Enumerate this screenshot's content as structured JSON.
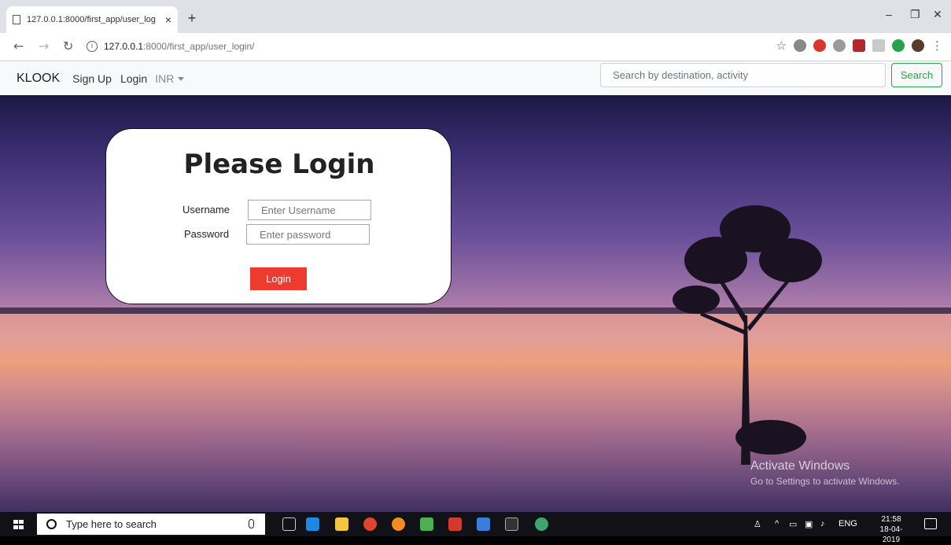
{
  "browser": {
    "tab_title": "127.0.0.1:8000/first_app/user_log",
    "tab_close": "×",
    "new_tab": "+",
    "url_host": "127.0.0.1",
    "url_path": ":8000/first_app/user_login/",
    "info": "i",
    "minimize": "–",
    "restore": "❐",
    "close": "✕"
  },
  "navbar": {
    "brand": "KLOOK",
    "links": [
      "Sign Up",
      "Login"
    ],
    "currency": "INR",
    "search_placeholder": "Search by destination, activity",
    "search_button": "Search"
  },
  "login": {
    "title": "Please Login",
    "username_label": "Username",
    "username_placeholder": "Enter Username",
    "password_label": "Password",
    "password_placeholder": "Enter password",
    "submit": "Login"
  },
  "watermark": {
    "title": "Activate Windows",
    "subtitle": "Go to Settings to activate Windows."
  },
  "taskbar": {
    "search_placeholder": "Type here to search",
    "language": "ENG",
    "time": "21:58",
    "date": "18-04-2019"
  },
  "colors": {
    "login_button": "#ee3a2f",
    "search_button": "#28a745"
  }
}
